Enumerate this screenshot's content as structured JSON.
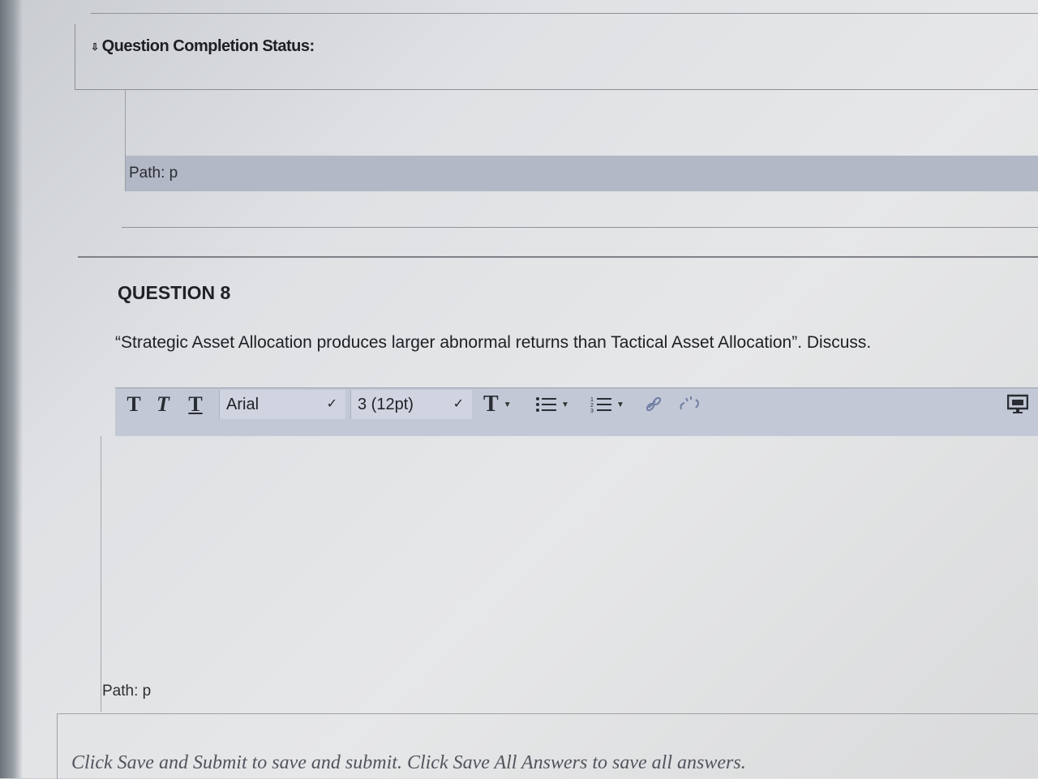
{
  "completion": {
    "header": "Question Completion Status:"
  },
  "editor_top": {
    "path": "Path: p"
  },
  "question": {
    "title": "QUESTION 8",
    "text": "“Strategic Asset Allocation produces larger abnormal returns than Tactical Asset Allocation”. Discuss."
  },
  "toolbar": {
    "bold": "T",
    "italic": "T",
    "underline": "T",
    "font_family": "Arial",
    "font_size": "3 (12pt)",
    "text_color": "T"
  },
  "editor_bottom": {
    "path": "Path: p"
  },
  "footer": {
    "text": "Click Save and Submit to save and submit. Click Save All Answers to save all answers."
  }
}
